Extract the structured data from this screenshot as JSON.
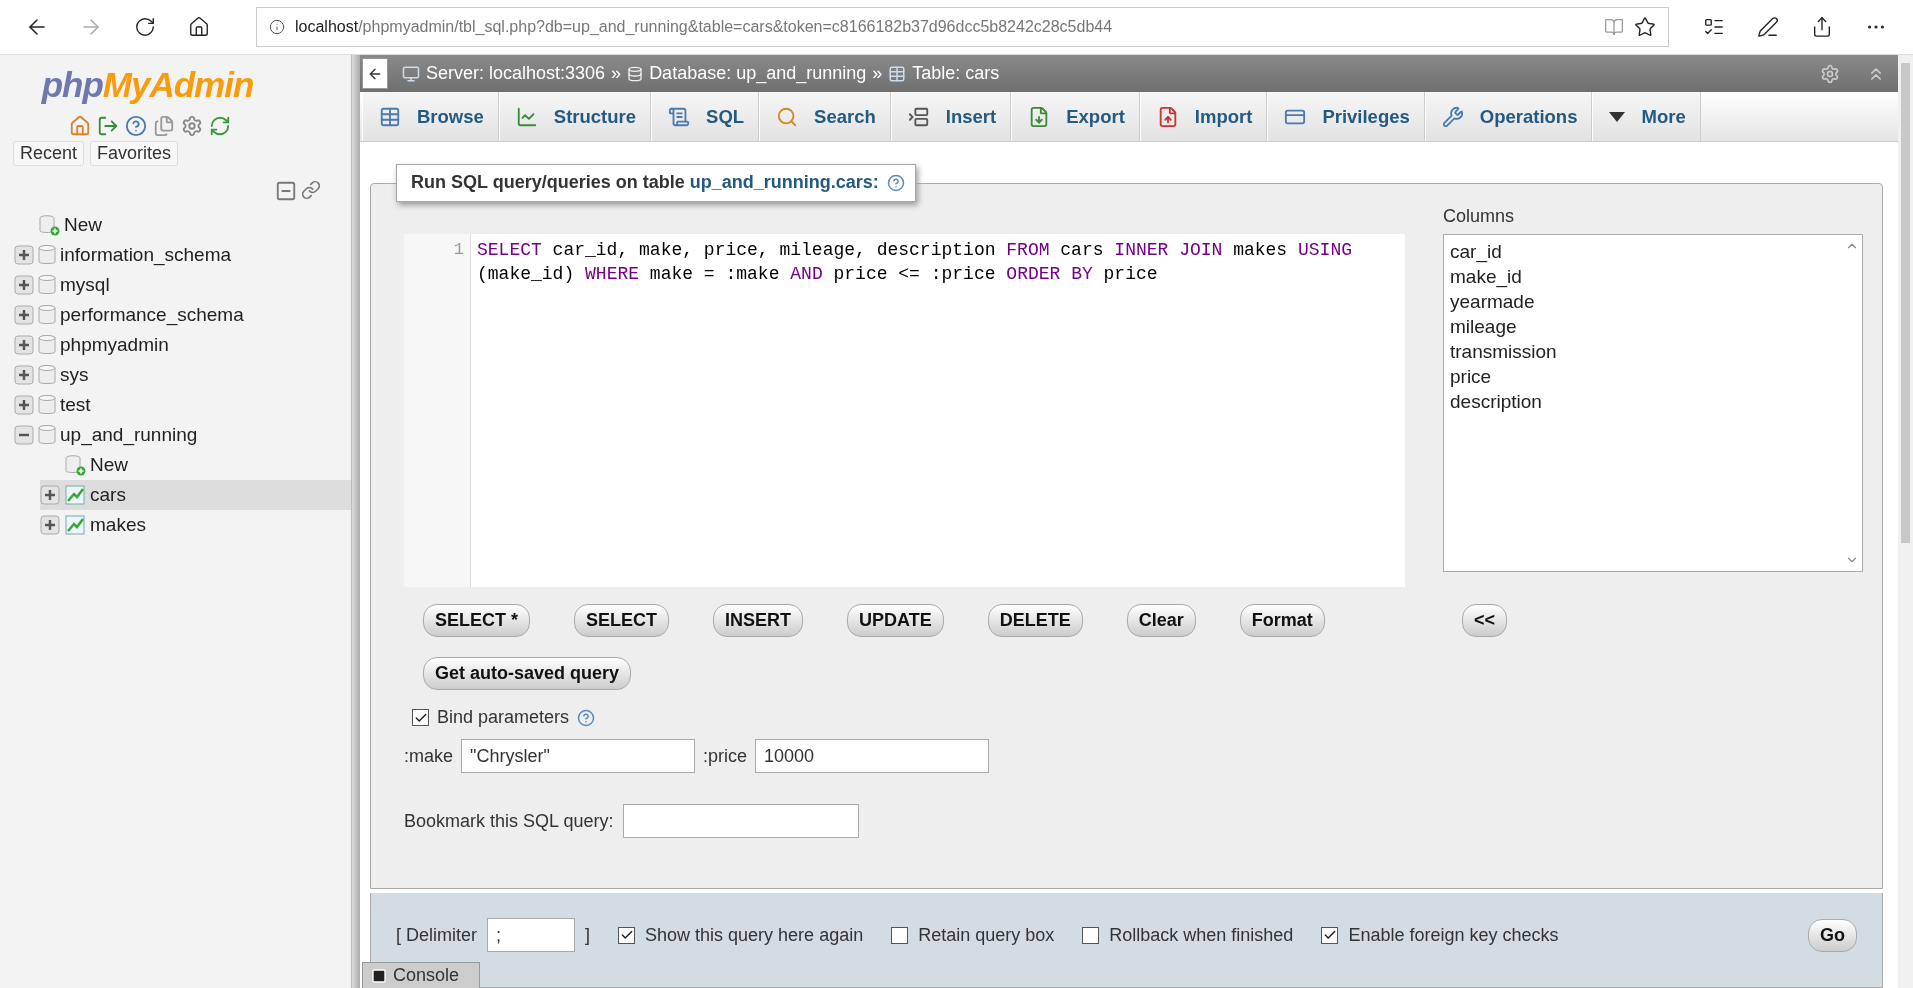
{
  "browser": {
    "url_host": "localhost",
    "url_path": "/phpmyadmin/tbl_sql.php?db=up_and_running&table=cars&token=c8166182b37d96dcc5b8242c28c5db44"
  },
  "sidebar": {
    "logo": {
      "first": "php",
      "second": "MyAdmin"
    },
    "quick_tabs": [
      "Recent",
      "Favorites"
    ],
    "tree": [
      {
        "kind": "new",
        "label": "New",
        "selected": false
      },
      {
        "kind": "database",
        "label": "information_schema",
        "expanded": false,
        "selected": false
      },
      {
        "kind": "database",
        "label": "mysql",
        "expanded": false,
        "selected": false
      },
      {
        "kind": "database",
        "label": "performance_schema",
        "expanded": false,
        "selected": false
      },
      {
        "kind": "database",
        "label": "phpmyadmin",
        "expanded": false,
        "selected": false
      },
      {
        "kind": "database",
        "label": "sys",
        "expanded": false,
        "selected": false
      },
      {
        "kind": "database",
        "label": "test",
        "expanded": false,
        "selected": false
      },
      {
        "kind": "database",
        "label": "up_and_running",
        "expanded": true,
        "selected": false,
        "children": [
          {
            "kind": "new",
            "label": "New",
            "selected": false
          },
          {
            "kind": "table",
            "label": "cars",
            "expanded": false,
            "selected": true
          },
          {
            "kind": "table",
            "label": "makes",
            "expanded": false,
            "selected": false
          }
        ]
      }
    ]
  },
  "breadcrumb": {
    "separator": "»",
    "items": [
      {
        "kind": "server",
        "label": "Server: localhost:3306"
      },
      {
        "kind": "database",
        "label": "Database: up_and_running"
      },
      {
        "kind": "table",
        "label": "Table: cars"
      }
    ]
  },
  "tabs": [
    {
      "kind": "browse",
      "label": "Browse",
      "selected": false
    },
    {
      "kind": "structure",
      "label": "Structure",
      "selected": false
    },
    {
      "kind": "sql",
      "label": "SQL",
      "selected": false
    },
    {
      "kind": "search",
      "label": "Search",
      "selected": false
    },
    {
      "kind": "insert",
      "label": "Insert",
      "selected": false
    },
    {
      "kind": "export",
      "label": "Export",
      "selected": false
    },
    {
      "kind": "import",
      "label": "Import",
      "selected": false
    },
    {
      "kind": "privileges",
      "label": "Privileges",
      "selected": false
    },
    {
      "kind": "operations",
      "label": "Operations",
      "selected": false
    },
    {
      "kind": "more",
      "label": "More",
      "selected": false
    }
  ],
  "query_box": {
    "legend": "Run SQL query/queries on table ",
    "legend_link": "up_and_running.cars:",
    "editor": {
      "lines": [
        {
          "number": "1",
          "tokens": [
            {
              "kind": "keyword",
              "text": "SELECT"
            },
            {
              "kind": "plain",
              "text": " car_id, make, price, mileage, description "
            },
            {
              "kind": "keyword",
              "text": "FROM"
            },
            {
              "kind": "plain",
              "text": " cars "
            },
            {
              "kind": "keyword",
              "text": "INNER JOIN"
            },
            {
              "kind": "plain",
              "text": " makes "
            },
            {
              "kind": "keyword",
              "text": "USING"
            },
            {
              "kind": "plain",
              "text": " (make_id) "
            },
            {
              "kind": "keyword",
              "text": "WHERE"
            },
            {
              "kind": "plain",
              "text": " make = :make "
            },
            {
              "kind": "keyword",
              "text": "AND"
            },
            {
              "kind": "plain",
              "text": " price <= :price "
            },
            {
              "kind": "keyword",
              "text": "ORDER BY"
            },
            {
              "kind": "plain",
              "text": " price"
            }
          ]
        }
      ]
    },
    "columns_label": "Columns",
    "columns": [
      "car_id",
      "make_id",
      "yearmade",
      "mileage",
      "transmission",
      "price",
      "description"
    ],
    "buttons": [
      "SELECT *",
      "SELECT",
      "INSERT",
      "UPDATE",
      "DELETE",
      "Clear",
      "Format"
    ],
    "insert_column_button": "<<",
    "autosave_button": "Get auto-saved query",
    "bind_parameters": {
      "label": "Bind parameters",
      "checked": true
    },
    "parameters": [
      {
        "name": ":make",
        "value": "\"Chrysler\""
      },
      {
        "name": ":price",
        "value": "10000"
      }
    ],
    "bookmark_label": "Bookmark this SQL query:"
  },
  "options": {
    "delimiter_label": "[ Delimiter",
    "delimiter": ";",
    "delimiter_close": "]",
    "checkboxes": [
      {
        "label": "Show this query here again",
        "checked": true
      },
      {
        "label": "Retain query box",
        "checked": false
      },
      {
        "label": "Rollback when finished",
        "checked": false
      },
      {
        "label": "Enable foreign key checks",
        "checked": true
      }
    ],
    "go_button": "Go"
  },
  "console": "Console"
}
